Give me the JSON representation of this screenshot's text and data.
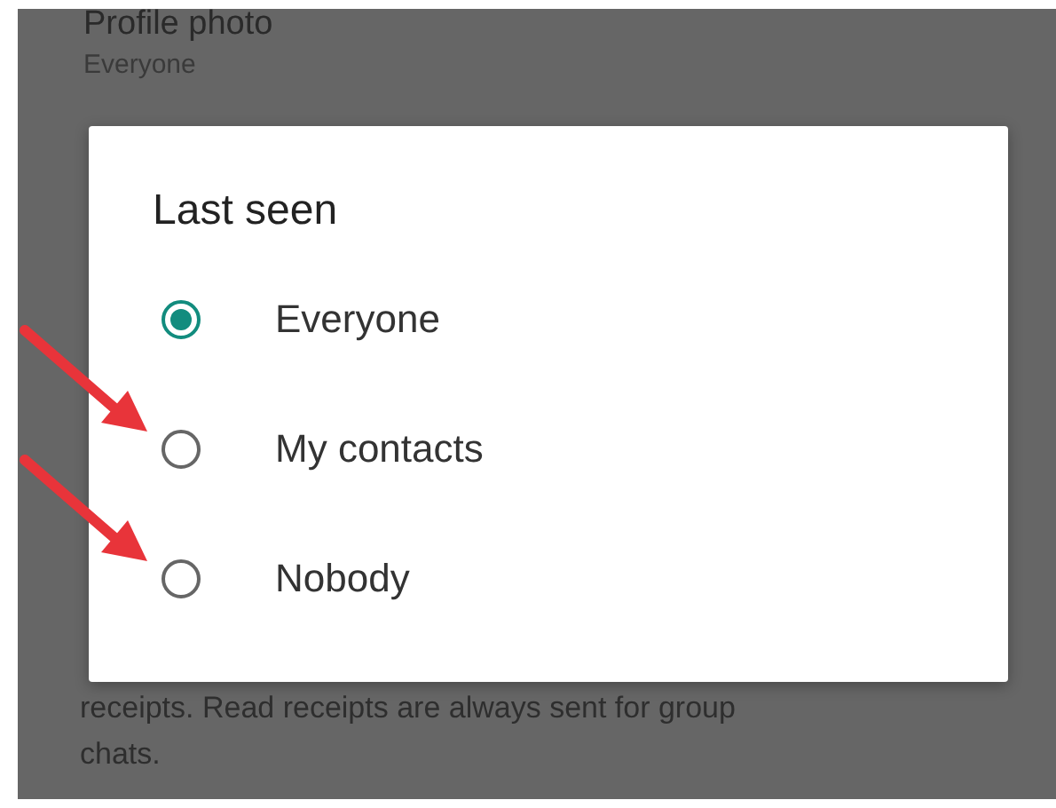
{
  "background": {
    "setting_title": "Profile photo",
    "setting_value": "Everyone",
    "note": "receipts. Read receipts are always sent for group chats."
  },
  "dialog": {
    "title": "Last seen",
    "options": [
      {
        "label": "Everyone",
        "selected": true
      },
      {
        "label": "My contacts",
        "selected": false,
        "arrow": true
      },
      {
        "label": "Nobody",
        "selected": false,
        "arrow": true
      }
    ]
  }
}
